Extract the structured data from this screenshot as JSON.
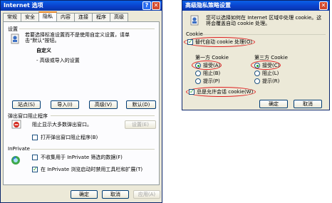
{
  "left_window": {
    "title": "Internet 选项",
    "tabs": [
      "常规",
      "安全",
      "隐私",
      "内容",
      "连接",
      "程序",
      "高级"
    ],
    "settings_group": "设置",
    "settings_desc_line1": "若要选择标准设置而不是使用自定义设置，请单",
    "settings_desc_line2": "击\"默认\"按钮。",
    "level_name": "自定义",
    "level_desc": "- 高级或导入的设置",
    "buttons": {
      "sites": "站点(S)",
      "import": "导入(I)",
      "advanced": "高级(V)",
      "default": "默认(D)"
    },
    "popup_group": "弹出窗口阻止程序",
    "popup_desc": "阻止显示大多数弹出窗口。",
    "popup_settings": "设置(E)",
    "popup_checkbox": "打开弹出窗口阻止程序(B)",
    "inprivate_group": "InPrivate",
    "inprivate_chk1": "不收集用于 InPrivate 筛选的数据(F)",
    "inprivate_chk2": "在 InPrivate 浏览启动时禁用工具栏和扩展(T)",
    "ok": "确定",
    "cancel": "取消",
    "apply": "应用(A)"
  },
  "right_window": {
    "title": "高级隐私策略设置",
    "desc_line1": "您可以选择如何在 Internet 区域中处理 cookie。这",
    "desc_line2": "将会覆盖自动 cookie 处理。",
    "cookie_group": "Cookie",
    "override_chk": "替代自动 cookie 处理(O)",
    "first_party_label": "第一方 Cookie",
    "third_party_label": "第三方 Cookie",
    "first_party_options": [
      "接受(A)",
      "阻止(B)",
      "提示(P)"
    ],
    "third_party_options": [
      "接受(C)",
      "阻止(L)",
      "提示(R)"
    ],
    "session_chk": "总是允许会话 cookie(W)",
    "ok": "确定",
    "cancel": "取消"
  }
}
